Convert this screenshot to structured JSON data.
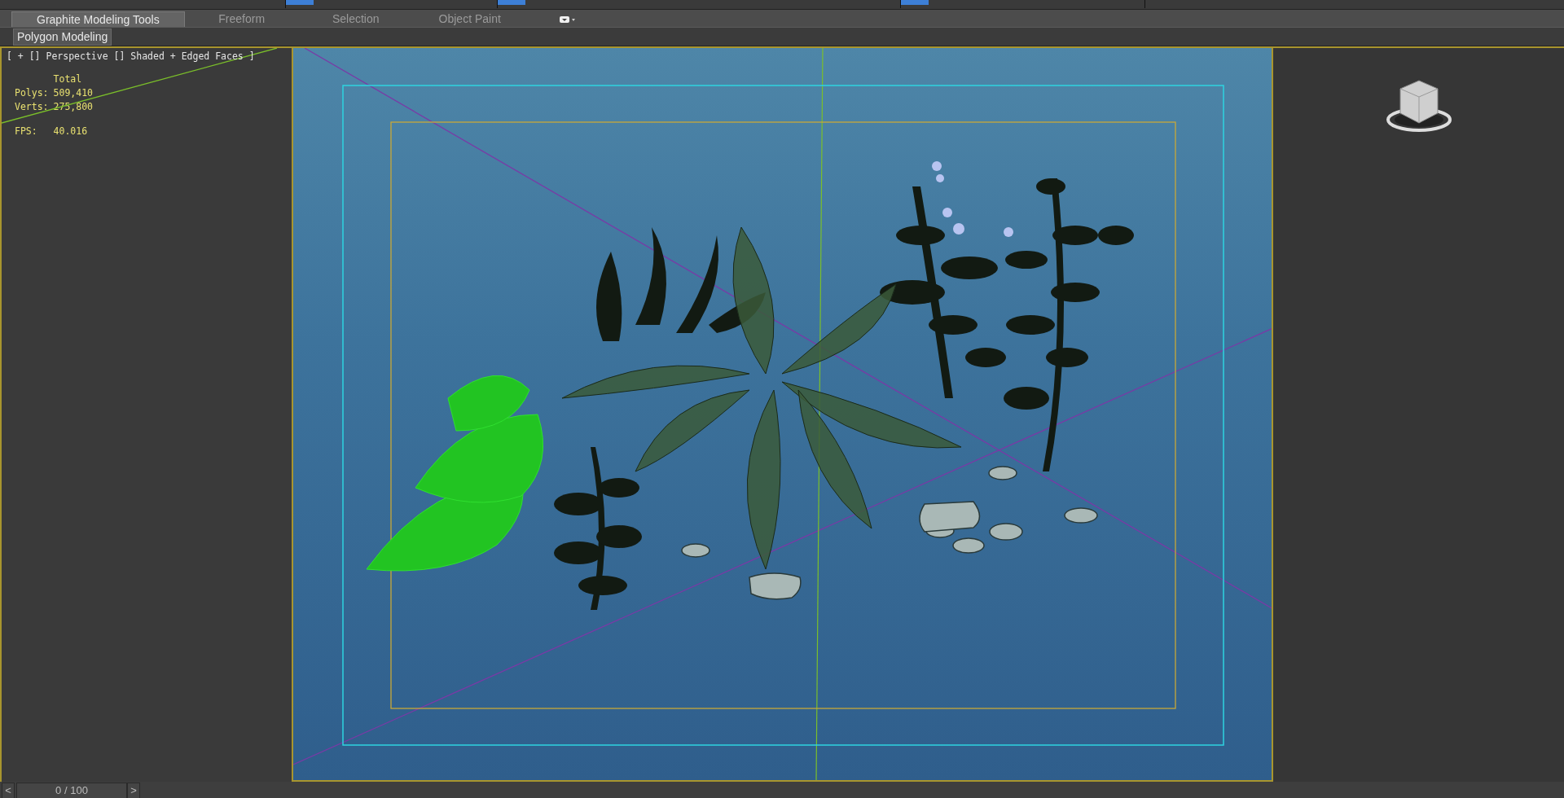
{
  "ribbon_tabs": [
    {
      "label": "Graphite Modeling Tools",
      "selected": true
    },
    {
      "label": "Freeform",
      "selected": false
    },
    {
      "label": "Selection",
      "selected": false
    },
    {
      "label": "Object Paint",
      "selected": false
    }
  ],
  "ribbon_panel": {
    "label": "Polygon Modeling"
  },
  "viewport": {
    "label": "[ + [] Perspective [] Shaded + Edged Faces ]",
    "stats": {
      "header": "Total",
      "rows": [
        {
          "label": "Polys:",
          "value": "509,410"
        },
        {
          "label": "Verts:",
          "value": "275,800"
        }
      ],
      "fps_label": "FPS:",
      "fps_value": "40.016"
    }
  },
  "timeline": {
    "prev": "<",
    "frame": "0 / 100",
    "level": 0,
    "next": ">"
  }
}
